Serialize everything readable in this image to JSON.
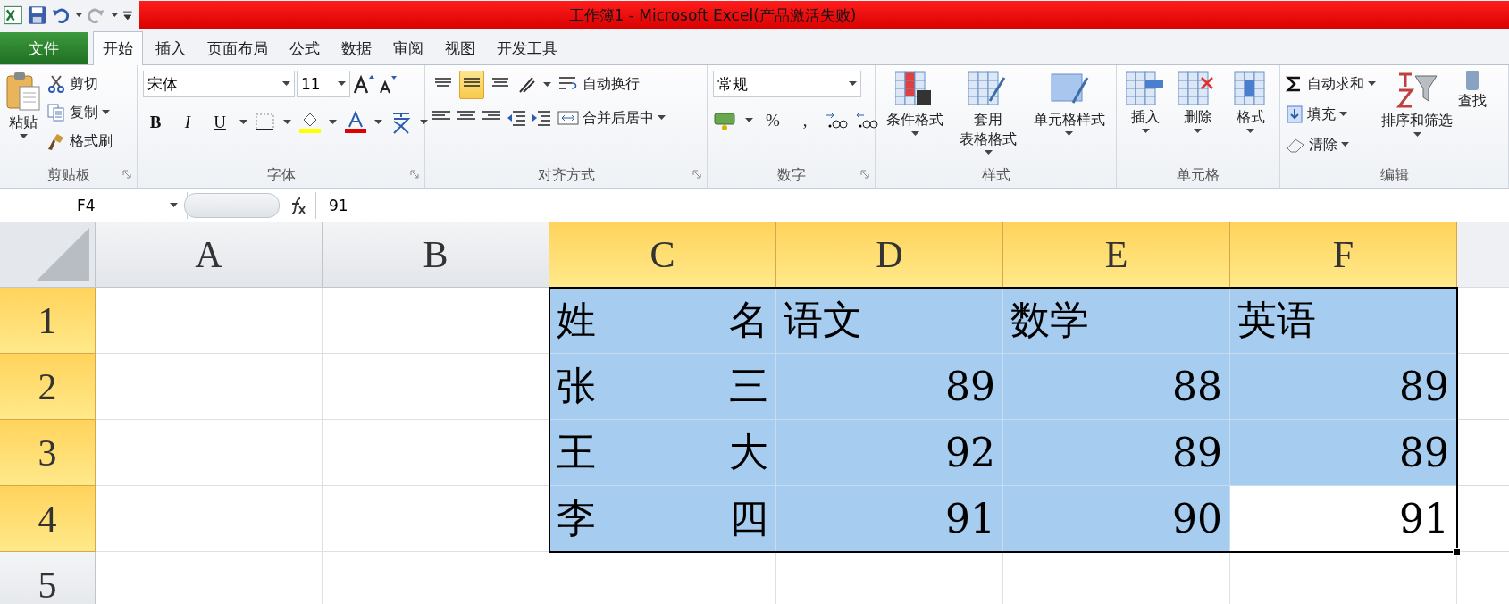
{
  "title_bar": {
    "title": "工作簿1 - Microsoft Excel(产品激活失败)"
  },
  "tabs": [
    {
      "label": "文件",
      "kind": "file",
      "selected": false
    },
    {
      "label": "开始",
      "kind": "tab",
      "selected": true
    },
    {
      "label": "插入",
      "kind": "tab",
      "selected": false
    },
    {
      "label": "页面布局",
      "kind": "tab",
      "selected": false
    },
    {
      "label": "公式",
      "kind": "tab",
      "selected": false
    },
    {
      "label": "数据",
      "kind": "tab",
      "selected": false
    },
    {
      "label": "审阅",
      "kind": "tab",
      "selected": false
    },
    {
      "label": "视图",
      "kind": "tab",
      "selected": false
    },
    {
      "label": "开发工具",
      "kind": "tab",
      "selected": false
    }
  ],
  "ribbon": {
    "groups": [
      {
        "kind": "clipboard",
        "label": "剪贴板",
        "paste": "粘贴",
        "commands": [
          "剪切",
          "复制",
          "格式刷"
        ]
      },
      {
        "kind": "font",
        "label": "字体",
        "font": "宋体",
        "size": "11",
        "styles": [
          "B",
          "I",
          "U"
        ]
      },
      {
        "kind": "alignment",
        "label": "对齐方式",
        "vertical_align": [
          {
            "selected": false
          },
          {
            "selected": true
          },
          {
            "selected": false
          }
        ],
        "wrap": "自动换行",
        "merge": "合并后居中"
      },
      {
        "kind": "number",
        "label": "数字",
        "format": "常规",
        "symbols": [
          "%",
          ","
        ]
      },
      {
        "kind": "styles",
        "label": "样式",
        "commands": [
          [
            "条件格式"
          ],
          [
            "套用",
            "表格格式"
          ],
          [
            "单元格样式"
          ]
        ]
      },
      {
        "kind": "cells",
        "label": "单元格",
        "commands": [
          "插入",
          "删除",
          "格式"
        ]
      },
      {
        "kind": "editing",
        "label": "编辑",
        "commands": [
          "自动求和",
          "填充",
          "清除"
        ],
        "sort": "排序和筛选",
        "find": "查找"
      }
    ]
  },
  "formula_bar": {
    "name_box": "F4",
    "value": "91"
  },
  "sheet": {
    "columns": [
      {
        "label": "A",
        "selected": false
      },
      {
        "label": "B",
        "selected": false
      },
      {
        "label": "C",
        "selected": true
      },
      {
        "label": "D",
        "selected": true
      },
      {
        "label": "E",
        "selected": true
      },
      {
        "label": "F",
        "selected": true
      }
    ],
    "rows": [
      {
        "label": "1",
        "selected": true,
        "cells": [
          {
            "selected": false
          },
          {
            "selected": false
          },
          {
            "text": "姓 名",
            "kind": "name",
            "selected": true
          },
          {
            "text": "语文",
            "kind": "heading",
            "selected": true
          },
          {
            "text": "数学",
            "kind": "heading",
            "selected": true
          },
          {
            "text": "英语",
            "kind": "heading",
            "selected": true
          }
        ]
      },
      {
        "label": "2",
        "selected": true,
        "cells": [
          {
            "selected": false
          },
          {
            "selected": false
          },
          {
            "text": "张 三",
            "kind": "name",
            "selected": true
          },
          {
            "text": "89",
            "kind": "number",
            "selected": true
          },
          {
            "text": "88",
            "kind": "number",
            "selected": true
          },
          {
            "text": "89",
            "kind": "number",
            "selected": true
          }
        ]
      },
      {
        "label": "3",
        "selected": true,
        "cells": [
          {
            "selected": false
          },
          {
            "selected": false
          },
          {
            "text": "王 大",
            "kind": "name",
            "selected": true
          },
          {
            "text": "92",
            "kind": "number",
            "selected": true
          },
          {
            "text": "89",
            "kind": "number",
            "selected": true
          },
          {
            "text": "89",
            "kind": "number",
            "selected": true
          }
        ]
      },
      {
        "label": "4",
        "selected": true,
        "cells": [
          {
            "selected": false
          },
          {
            "selected": false
          },
          {
            "text": "李 四",
            "kind": "name",
            "selected": true
          },
          {
            "text": "91",
            "kind": "number",
            "selected": true
          },
          {
            "text": "90",
            "kind": "number",
            "selected": true
          },
          {
            "text": "91",
            "kind": "number",
            "selected": true,
            "active": true
          }
        ]
      },
      {
        "label": "5",
        "selected": false,
        "cells": [
          {
            "selected": false
          },
          {
            "selected": false
          },
          {
            "selected": false
          },
          {
            "selected": false
          },
          {
            "selected": false
          },
          {
            "selected": false
          }
        ]
      }
    ]
  }
}
